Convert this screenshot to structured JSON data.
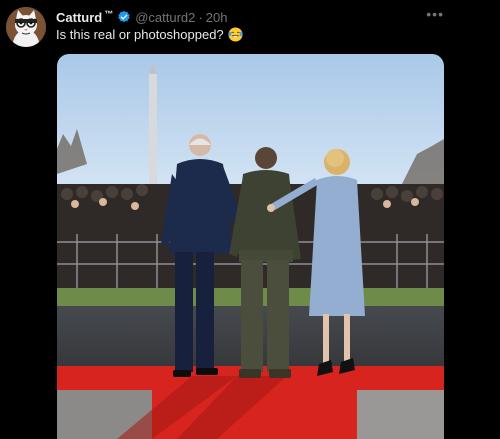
{
  "tweet": {
    "display_name": "Catturd",
    "trademark": "™",
    "handle": "@catturd2",
    "separator": "·",
    "time": "20h",
    "text": "Is this real or photoshopped?",
    "emoji": "face-with-tears-of-joy-icon",
    "more_label": "•••",
    "avatar_icon": "cat-avatar-icon",
    "verified_icon": "verified-badge-icon"
  },
  "colors": {
    "background": "#000000",
    "text_primary": "#e7e9ea",
    "text_secondary": "#71767b",
    "verified_blue": "#1d9bf0",
    "red_carpet": "#e0241f"
  }
}
